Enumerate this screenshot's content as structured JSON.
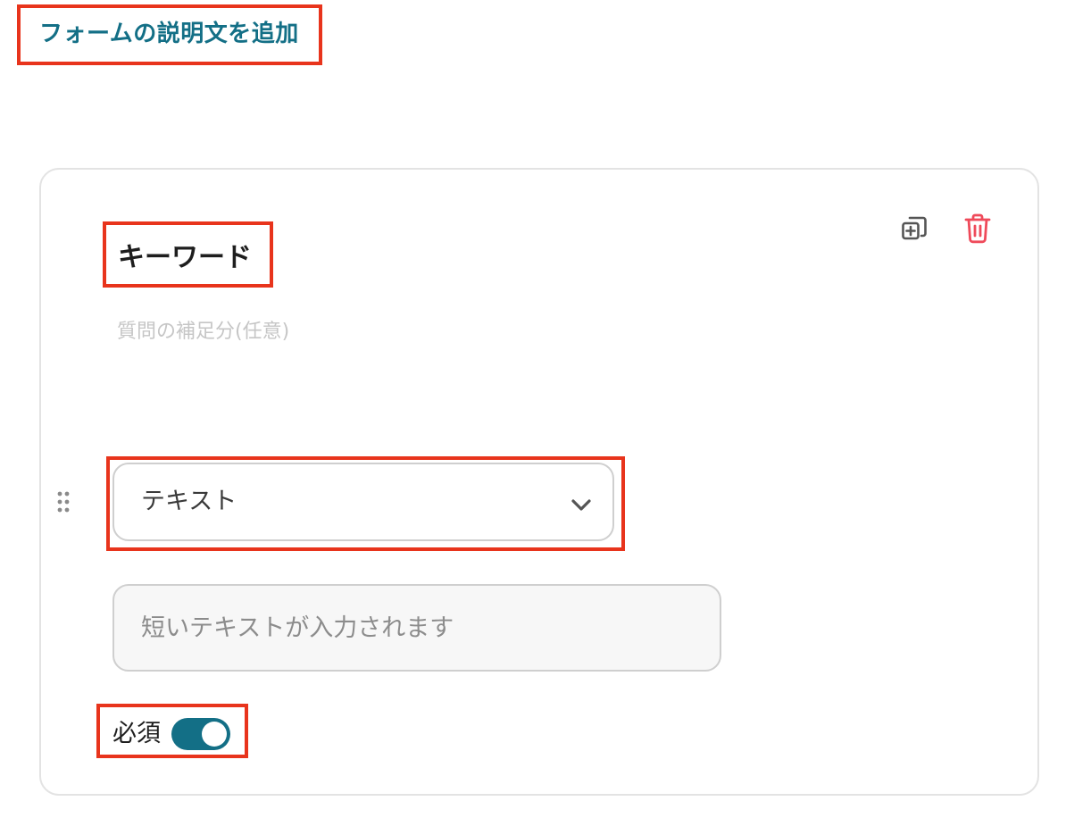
{
  "form": {
    "add_description_label": "フォームの説明文を追加"
  },
  "question": {
    "title": "キーワード",
    "note_placeholder": "質問の補足分(任意)",
    "type_select": {
      "selected": "テキスト"
    },
    "answer_input": {
      "placeholder": "短いテキストが入力されます",
      "value": ""
    },
    "required": {
      "label": "必須",
      "on": true
    },
    "icons": {
      "duplicate": "copy-plus-icon",
      "delete": "trash-icon",
      "drag": "drag-handle-icon",
      "chevron": "chevron-down-icon"
    }
  },
  "colors": {
    "accent": "#136f86",
    "danger": "#ef4a5a",
    "highlight": "#e8341c"
  }
}
